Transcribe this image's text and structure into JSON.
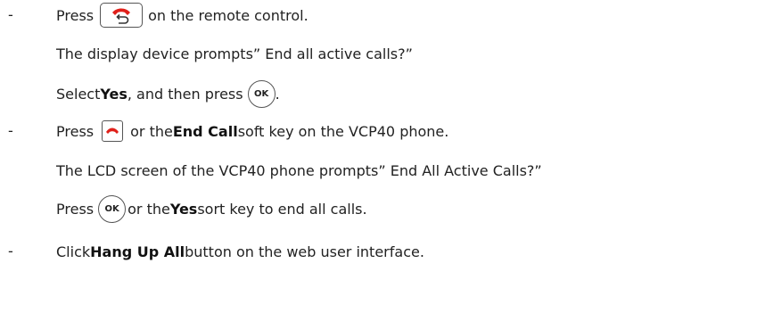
{
  "bullet": "-",
  "step1": {
    "press": "Press",
    "after_icon": "on the remote control.",
    "icon": "remote-hangup-key-icon",
    "prompt_line": "The display device prompts” End all active calls?”",
    "select": "Select ",
    "yes": "Yes",
    "then_press": ", and then press",
    "ok_label": "OK",
    "end_period": "."
  },
  "step2": {
    "press": "Press",
    "or_the": "or the ",
    "end_call": "End Call",
    "soft_key_text": " soft key on the VCP40 phone.",
    "icon": "phone-hangup-key-icon",
    "prompt_line": "The LCD screen of the VCP40 phone prompts” End All Active Calls?”",
    "press2": "Press",
    "ok_label": "OK",
    "or_the2": "or the ",
    "yes": "Yes",
    "sort_key_text": " sort key to end all calls."
  },
  "step3": {
    "click": "Click ",
    "hang_up_all": "Hang Up All",
    "rest": " button on the web user interface."
  },
  "colors": {
    "hangup_red": "#e0201a",
    "text": "#222222"
  }
}
